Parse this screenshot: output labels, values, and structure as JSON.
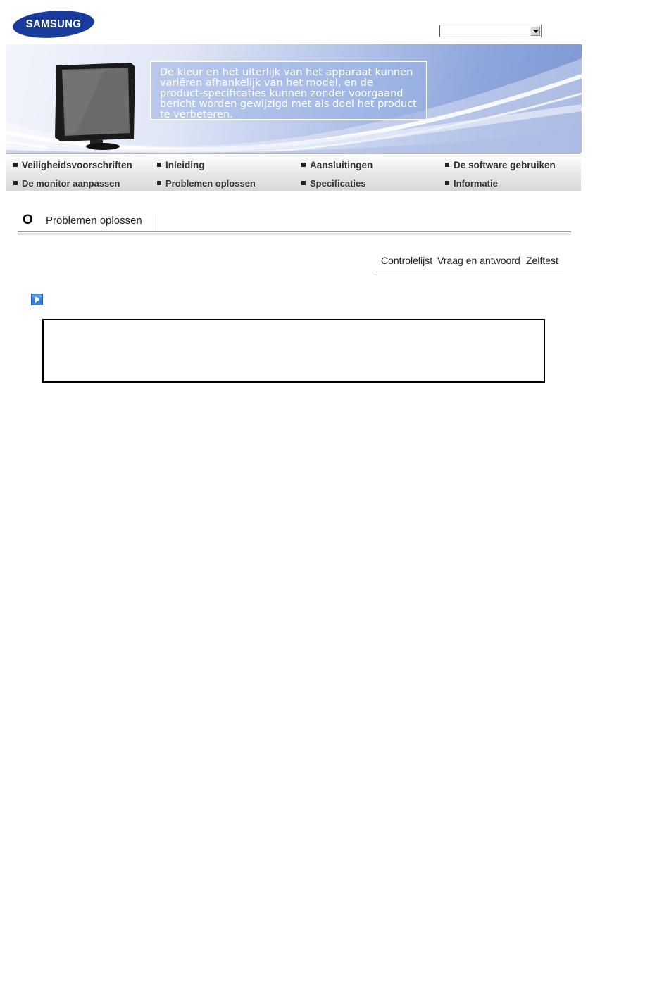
{
  "brand": {
    "logo_text": "SAMSUNG",
    "logo_color": "#1a3c9c"
  },
  "model_select": {
    "value": ""
  },
  "banner": {
    "note": "De kleur en het uiterlijk van het apparaat kunnen variëren afhankelijk van het model, en de product-specificaties kunnen zonder voorgaand bericht worden gewijzigd met als doel het product te verbeteren."
  },
  "nav": {
    "items": [
      {
        "label": "Veiligheidsvoorschriften"
      },
      {
        "label": "Inleiding"
      },
      {
        "label": "Aansluitingen"
      },
      {
        "label": "De software gebruiken"
      },
      {
        "label": "De monitor aanpassen"
      },
      {
        "label": "Problemen oplossen"
      },
      {
        "label": "Specificaties"
      },
      {
        "label": "Informatie"
      }
    ]
  },
  "section": {
    "marker": "O",
    "title": "Problemen oplossen"
  },
  "subtabs": [
    {
      "label": "Controlelijst"
    },
    {
      "label": "Vraag en antwoord"
    },
    {
      "label": "Zelftest"
    }
  ]
}
